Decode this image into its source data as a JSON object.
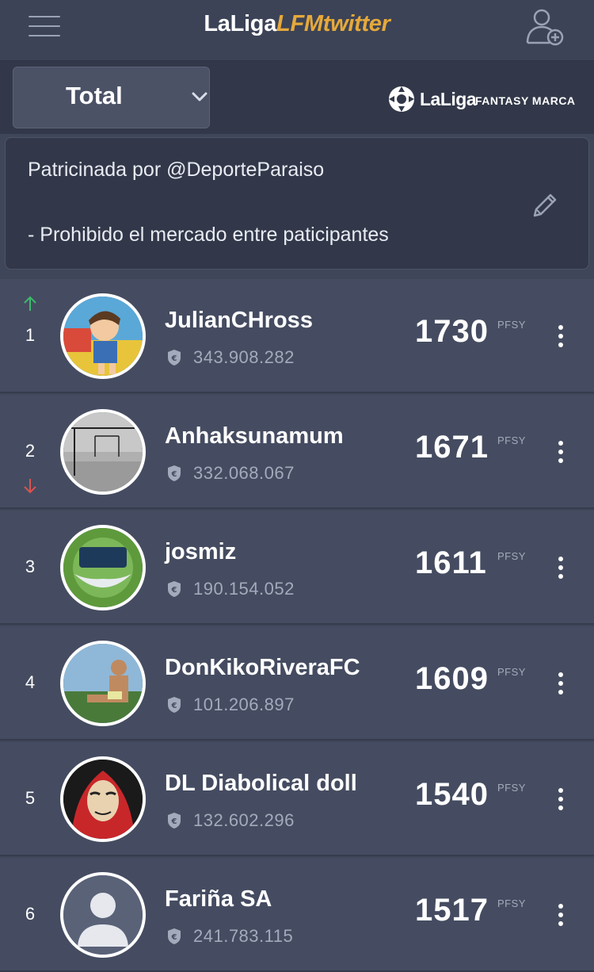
{
  "header": {
    "brand_part1": "LaLiga",
    "brand_part2": "LFMtwitter",
    "menu_icon": "hamburger-icon",
    "add_user_icon": "add-user-icon"
  },
  "filter": {
    "selected": "Total"
  },
  "sponsor": {
    "logo_word": "LaLiga",
    "logo_word2": "FANTASY MARCA"
  },
  "description": {
    "line1": "Patricinada por @DeporteParaiso",
    "line2": "- Prohibido el mercado entre paticipantes"
  },
  "colors": {
    "accent": "#e6a93a",
    "up": "#3dba6a",
    "down": "#d9534f"
  },
  "ranking": [
    {
      "rank": "1",
      "trend": "up",
      "name": "JulianCHross",
      "value": "343.908.282",
      "points": "1730",
      "unit": "PFSY"
    },
    {
      "rank": "2",
      "trend": "down",
      "name": "Anhaksunamum",
      "value": "332.068.067",
      "points": "1671",
      "unit": "PFSY"
    },
    {
      "rank": "3",
      "trend": "none",
      "name": "josmiz",
      "value": "190.154.052",
      "points": "1611",
      "unit": "PFSY"
    },
    {
      "rank": "4",
      "trend": "none",
      "name": "DonKikoRiveraFC",
      "value": "101.206.897",
      "points": "1609",
      "unit": "PFSY"
    },
    {
      "rank": "5",
      "trend": "none",
      "name": "DL Diabolical doll",
      "value": "132.602.296",
      "points": "1540",
      "unit": "PFSY"
    },
    {
      "rank": "6",
      "trend": "none",
      "name": "Fariña SA",
      "value": "241.783.115",
      "points": "1517",
      "unit": "PFSY"
    }
  ]
}
